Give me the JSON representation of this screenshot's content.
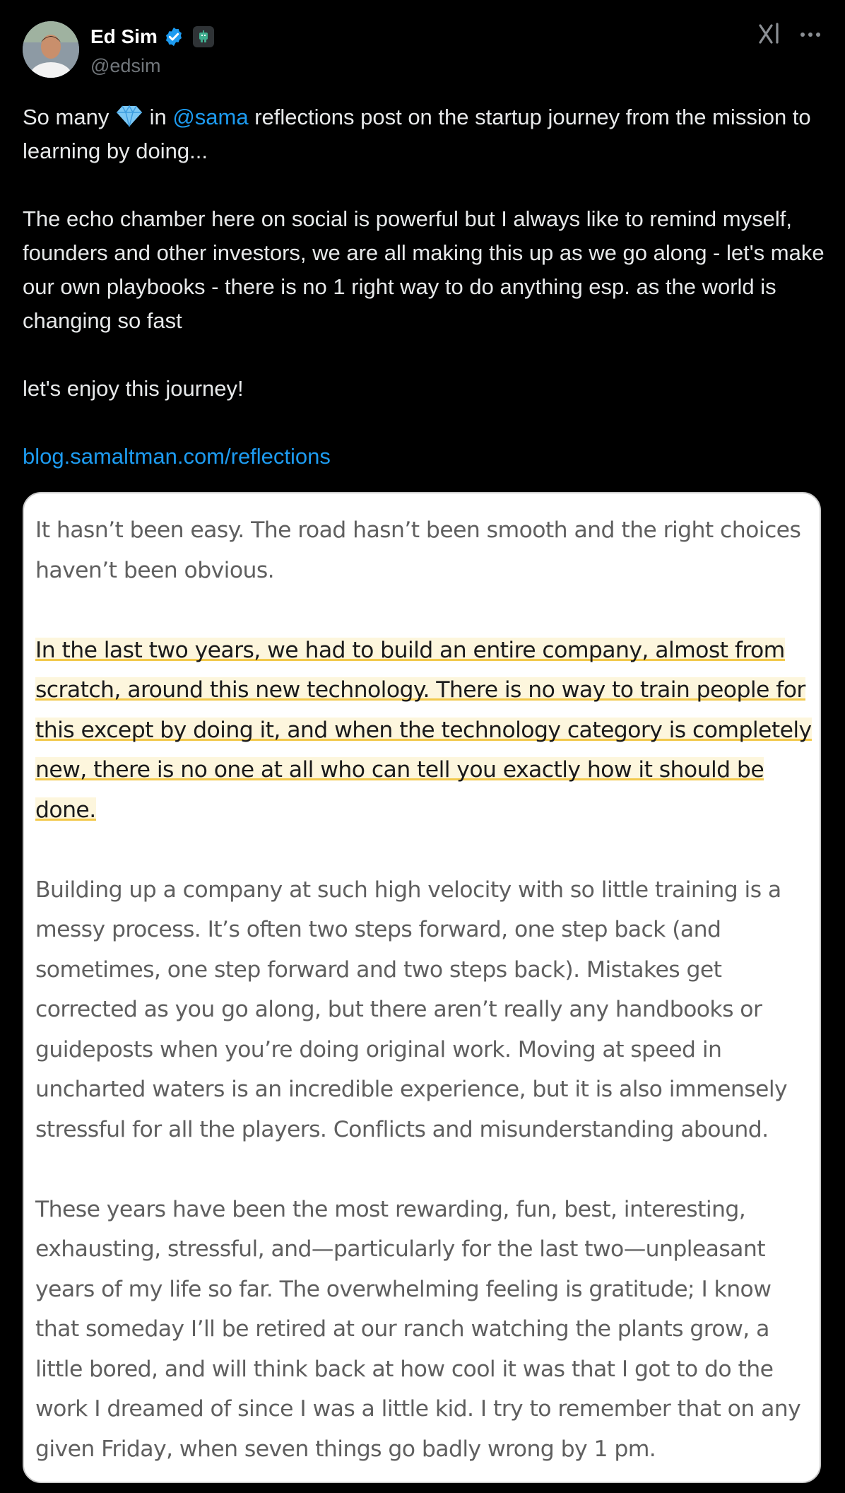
{
  "author": {
    "name": "Ed Sim",
    "handle": "@edsim",
    "verified_icon": "verified-badge-icon",
    "affiliate_icon": "robot-badge-icon"
  },
  "header_actions": {
    "grok_icon": "grok-icon",
    "more_icon": "more-horizontal-icon"
  },
  "tweet": {
    "line1_prefix": "So many ",
    "emoji": "gem-icon",
    "line1_in": " in ",
    "mention": "@sama",
    "line1_suffix": " reflections post on the startup journey from the mission to learning by doing...",
    "paragraph2": "The echo chamber here on social is powerful but I always like to remind myself, founders and other investors, we are all making this up as we go along  - let's make our own playbooks - there is no 1 right way to do anything esp. as the world is changing so fast",
    "paragraph3": "let's enjoy this journey!",
    "link": "blog.samaltman.com/reflections"
  },
  "quote": {
    "p1": "It hasn’t been easy. The road hasn’t been smooth and the right choices haven’t been obvious.",
    "p2_highlighted": "In the last two years, we had to build an entire company, almost from scratch, around this new technology. There is no way to train people for this except by doing it, and when the technology category is completely new, there is no one at all who can tell you exactly how it should be done.",
    "p3": "Building up a company at such high velocity with so little training is a messy process. It’s often two steps forward, one step back (and sometimes, one step forward and two steps back). Mistakes get corrected as you go along, but there aren’t really any handbooks or guideposts when you’re doing original work. Moving at speed in uncharted waters is an incredible experience, but it is also immensely stressful for all the players. Conflicts and misunderstanding abound.",
    "p4": "These years have been the most rewarding, fun, best, interesting, exhausting, stressful, and—particularly for the last two—unpleasant years of my life so far. The overwhelming feeling is gratitude; I know that someday I’ll be retired at our ranch watching the plants grow, a little bored, and will think back at how cool it was that I got to do the work I dreamed of since I was a little kid. I try to remember that on any given Friday, when seven things go badly wrong by 1 pm."
  },
  "colors": {
    "background": "#000000",
    "link": "#1d9bf0",
    "highlight_fill": "#fdf6dd",
    "highlight_underline": "#f2c94c"
  }
}
